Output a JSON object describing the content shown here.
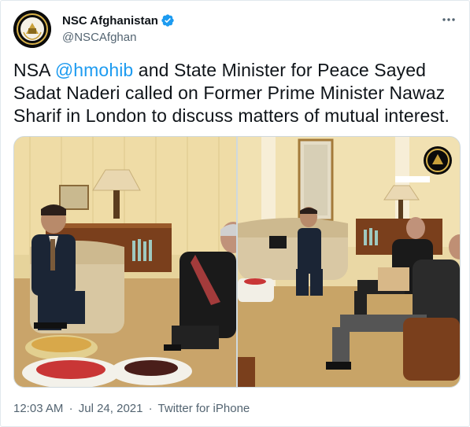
{
  "account": {
    "display_name": "NSC Afghanistan",
    "handle": "@NSCAfghan",
    "verified": true
  },
  "tweet": {
    "prefix": "NSA ",
    "mention": "@hmohib",
    "body": " and State Minister for Peace Sayed Sadat Naderi called on Former Prime Minister Nawaz Sharif in London to discuss matters of mutual interest."
  },
  "media": {
    "photos": [
      {
        "alt": "photo-1",
        "icon": "meeting-photo"
      },
      {
        "alt": "photo-2",
        "icon": "meeting-photo"
      }
    ],
    "colors": {
      "wall": "#e8d6a0",
      "carpet": "#c9a66b"
    }
  },
  "meta": {
    "time": "12:03 AM",
    "date": "Jul 24, 2021",
    "source": "Twitter for iPhone",
    "separator": "·"
  },
  "colors": {
    "link": "#1d9bf0",
    "text": "#0f1419",
    "muted": "#536471",
    "border": "#cfd9de"
  },
  "icons": {
    "verified": "verified-badge-icon",
    "more": "more-options-icon"
  }
}
